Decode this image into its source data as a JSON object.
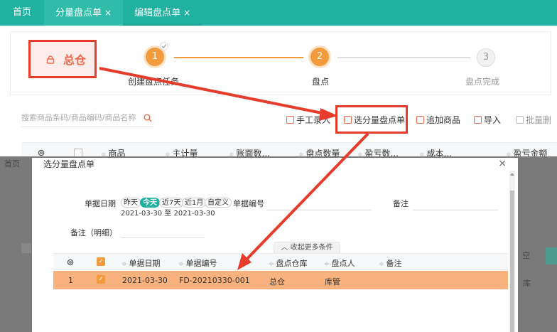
{
  "tabs": [
    {
      "label": "首页"
    },
    {
      "label": "分量盘点单",
      "close": "×"
    },
    {
      "label": "编辑盘点单",
      "close": "×"
    }
  ],
  "warehouse": {
    "label": "总仓",
    "icon": "lock-icon"
  },
  "steps": [
    {
      "number": "1",
      "label": "创建盘点任务",
      "state": "done"
    },
    {
      "number": "2",
      "label": "盘点",
      "state": "current"
    },
    {
      "number": "3",
      "label": "盘点完成",
      "state": "todo"
    }
  ],
  "search": {
    "placeholder": "搜索商品条码/商品编码/商品名称",
    "icon": "search-icon"
  },
  "toolbar": {
    "manual_entry": "手工录入",
    "select_sheet": "选分量盘点单",
    "add_product": "追加商品",
    "import": "导入",
    "batch_delete": "批量删"
  },
  "main_table": {
    "headers": [
      "商品",
      "主计量",
      "账面数...",
      "盘点数量",
      "盈亏数...",
      "成本...",
      "盈亏金额"
    ]
  },
  "background_fragments": {
    "left_top": "首页",
    "right_mid": "空",
    "right_row": "库"
  },
  "modal": {
    "title": "选分量盘点单",
    "close": "×",
    "filters": {
      "date_label": "单据日期",
      "date_chips": [
        "昨天",
        "今天",
        "近7天",
        "近1月",
        "自定义"
      ],
      "active_chip": "今天",
      "date_range": "2021-03-30 至 2021-03-30",
      "doc_no_label": "单据编号",
      "remark_label": "备注",
      "detail_remark_label": "备注（明细）",
      "collapse": "收起更多条件"
    },
    "table": {
      "headers": [
        "单据日期",
        "单据编号",
        "盘点仓库",
        "盘点人",
        "备注"
      ],
      "rows": [
        {
          "index": "1",
          "checked": "✓",
          "date": "2021-03-30",
          "doc_no": "FD-20210330-001",
          "warehouse": "总仓",
          "person": "库管",
          "remark": ""
        }
      ]
    }
  },
  "colors": {
    "teal": "#20b1a1",
    "orange": "#f39a3d",
    "red_annotation": "#e73b2c",
    "row_highlight": "#f9b27d"
  }
}
